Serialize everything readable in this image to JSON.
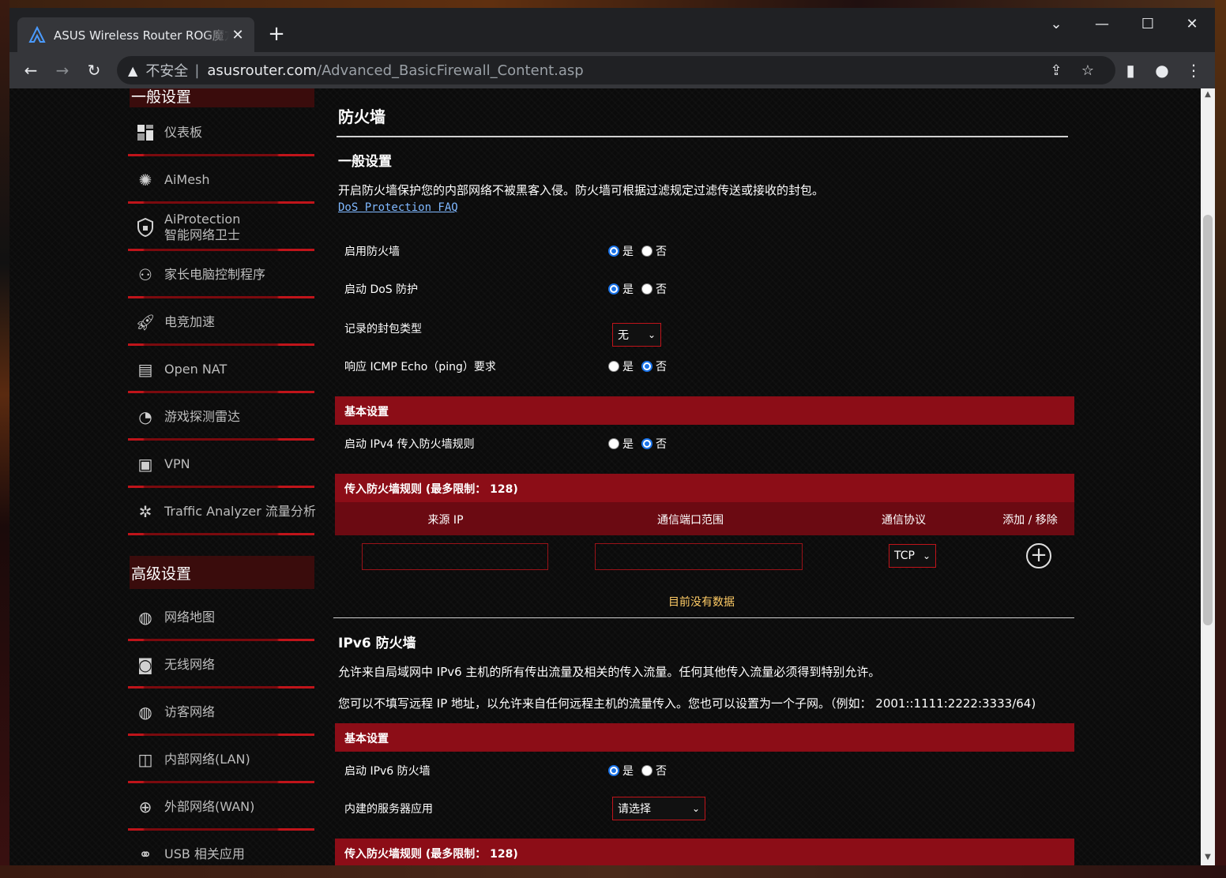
{
  "browser": {
    "tab_title": "ASUS Wireless Router ROG魔方",
    "newtab": "+",
    "close": "✕",
    "insecure_label": "不安全",
    "separator": "|",
    "url_host": "asusrouter.com",
    "url_path": "/Advanced_BasicFirewall_Content.asp"
  },
  "sidebar": {
    "general_head": "一般设置",
    "general_items": [
      {
        "label": "仪表板",
        "icon": "dashboard-icon"
      },
      {
        "label": "AiMesh",
        "icon": "aimesh-icon"
      },
      {
        "label": "AiProtection",
        "label2": "智能网络卫士",
        "icon": "shield-icon"
      },
      {
        "label": "家长电脑控制程序",
        "icon": "parental-icon"
      },
      {
        "label": "电竞加速",
        "icon": "rocket-icon"
      },
      {
        "label": "Open NAT",
        "icon": "open-nat-icon"
      },
      {
        "label": "游戏探测雷达",
        "icon": "radar-icon"
      },
      {
        "label": "VPN",
        "icon": "vpn-icon"
      },
      {
        "label": "Traffic Analyzer 流量分析",
        "icon": "traffic-icon"
      }
    ],
    "advanced_head": "高级设置",
    "advanced_items": [
      {
        "label": "网络地图",
        "icon": "globe-icon"
      },
      {
        "label": "无线网络",
        "icon": "wireless-icon"
      },
      {
        "label": "访客网络",
        "icon": "guest-icon"
      },
      {
        "label": "内部网络(LAN)",
        "icon": "lan-icon"
      },
      {
        "label": "外部网络(WAN)",
        "icon": "wan-icon"
      },
      {
        "label": "USB 相关应用",
        "icon": "usb-icon"
      }
    ]
  },
  "main": {
    "title": "防火墙",
    "general_title": "一般设置",
    "general_desc": "开启防火墙保护您的内部网络不被黑客入侵。防火墙可根据过滤规定过滤传送或接收的封包。",
    "faq_link": "DoS Protection FAQ",
    "yes": "是",
    "no": "否",
    "rows": {
      "enable_fw": "启用防火墙",
      "enable_dos": "启动 DoS 防护",
      "log_type": "记录的封包类型",
      "log_type_value": "无",
      "icmp": "响应 ICMP Echo（ping）要求"
    },
    "basic_bar": "基本设置",
    "ipv4_rule": "启动 IPv4 传入防火墙规则",
    "inbound_bar": "传入防火墙规则 (最多限制： 128)",
    "table_headers": {
      "source_ip": "来源 IP",
      "port_range": "通信端口范围",
      "protocol": "通信协议",
      "add_remove": "添加 / 移除"
    },
    "protocol_value": "TCP",
    "add_symbol": "+",
    "no_data": "目前没有数据",
    "ipv6_title": "IPv6 防火墙",
    "ipv6_desc1": "允许来自局域网中 IPv6 主机的所有传出流量及相关的传入流量。任何其他传入流量必须得到特别允许。",
    "ipv6_desc2": "您可以不填写远程 IP 地址，以允许来自任何远程主机的流量传入。您也可以设置为一个子网。（例如： 2001::1111:2222:3333/64)",
    "ipv6_basic_bar": "基本设置",
    "ipv6_enable": "启动 IPv6 防火墙",
    "ipv6_service": "内建的服务器应用",
    "ipv6_service_value": "请选择",
    "ipv6_inbound_bar": "传入防火墙规则 (最多限制： 128)"
  },
  "colors": {
    "accent_red": "#8c0d17",
    "radio_blue": "#1a73e8",
    "no_data_gold": "#ffcc66"
  }
}
